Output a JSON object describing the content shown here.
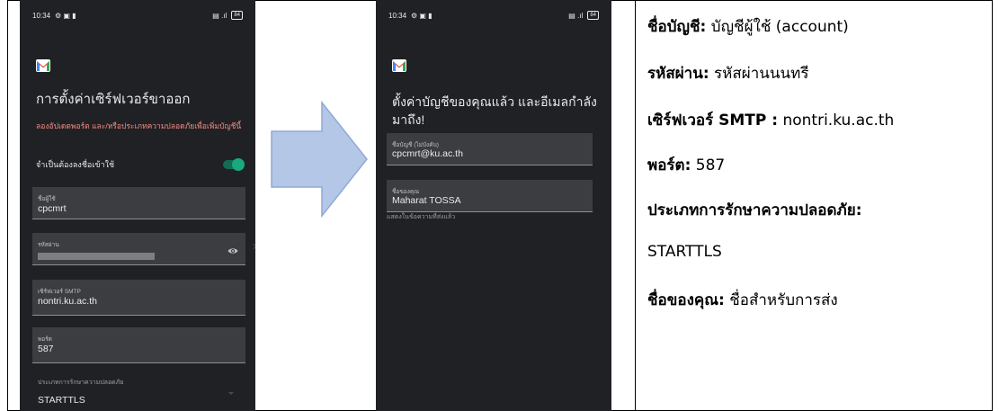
{
  "phone1": {
    "status_time": "10:34",
    "title": "การตั้งค่าเซิร์ฟเวอร์ขาออก",
    "warning": "ลองอัปเดตพอร์ต และ/หรือประเภทความปลอดภัยเพื่อเพิ่มบัญชีนี้",
    "require_signin_label": "จำเป็นต้องลงชื่อเข้าใช้",
    "require_signin_on": true,
    "fields": {
      "username": {
        "label": "ชื่อผู้ใช้",
        "value": "cpcmrt"
      },
      "password": {
        "label": "รหัสผ่าน"
      },
      "smtp_server": {
        "label": "เซิร์ฟเวอร์ SMTP",
        "value": "nontri.ku.ac.th"
      },
      "port": {
        "label": "พอร์ต",
        "value": "587"
      }
    },
    "security_type_label": "ประเภทการรักษาความปลอดภัย",
    "security_type_value": "STARTTLS"
  },
  "phone2": {
    "status_time": "10:34",
    "title": "ตั้งค่าบัญชีของคุณแล้ว และอีเมลกำลังมาถึง!",
    "account_field": {
      "label": "ชื่อบัญชี (ไม่บังคับ)",
      "value": "cpcmrt@ku.ac.th"
    },
    "name_field": {
      "label": "ชื่อของคุณ",
      "value": "Maharat TOSSA"
    },
    "name_hint": "แสดงในข้อความที่ส่งแล้ว"
  },
  "info": {
    "account_label": "ชื่อบัญชี:",
    "account_value": "บัญชีผู้ใช้ (account)",
    "password_label": "รหัสผ่าน:",
    "password_value": "รหัสผ่านนนทรี",
    "smtp_label": "เซิร์ฟเวอร์ SMTP :",
    "smtp_value": "nontri.ku.ac.th",
    "port_label": "พอร์ต:",
    "port_value": "587",
    "security_label": "ประเภทการรักษาความปลอดภัย:",
    "security_value": "STARTTLS",
    "name_label": "ชื่อของคุณ:",
    "name_value": "ชื่อสำหรับการส่ง"
  },
  "colors": {
    "phone_bg": "#202124",
    "field_bg": "#3c3d40",
    "warning": "#f28b82",
    "toggle_on": "#1aa87e",
    "arrow_fill": "#b4c7e7",
    "arrow_stroke": "#8fa9d6"
  },
  "icons": [
    "gmail-logo-icon",
    "eye-icon",
    "arrow-right-icon",
    "clear-icon",
    "dropdown-caret-icon"
  ]
}
